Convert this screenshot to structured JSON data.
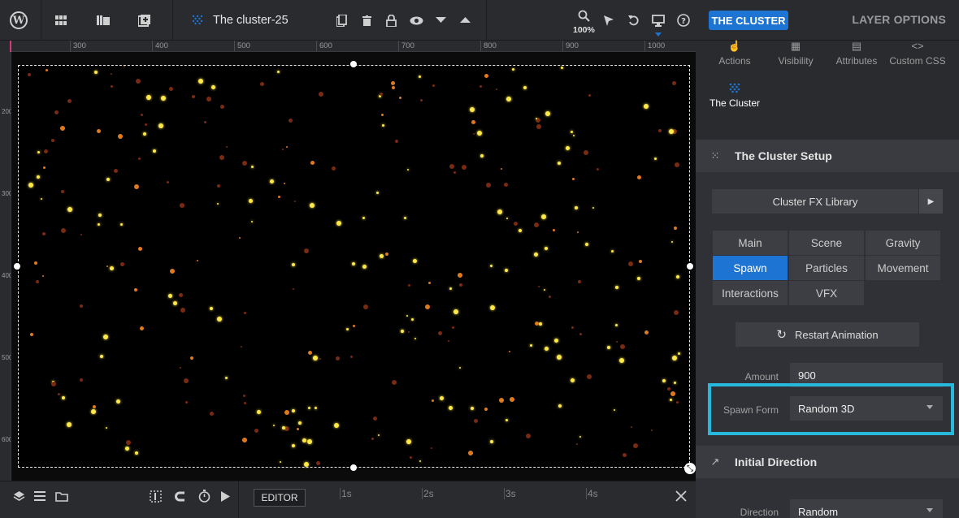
{
  "toolbar": {
    "title": "The cluster-25",
    "zoom": "100%",
    "icons": [
      "wordpress-icon",
      "grid-icon",
      "library-icon",
      "add-slide-icon",
      "cluster-icon",
      "duplicate-icon",
      "trash-icon",
      "lock-icon",
      "eye-icon",
      "chevron-down-icon",
      "chevron-up-icon",
      "search-icon",
      "pointer-icon",
      "undo-icon",
      "desktop-icon",
      "help-icon"
    ]
  },
  "ruler": {
    "top_labels": [
      "300",
      "400",
      "500",
      "600",
      "700",
      "800",
      "900",
      "1000"
    ],
    "left_labels": [
      "200",
      "300",
      "400",
      "500",
      "600"
    ]
  },
  "bottom": {
    "editor_label": "EDITOR",
    "timeline_labels": [
      "1s",
      "2s",
      "3s",
      "4s"
    ]
  },
  "panel": {
    "header_button": "THE CLUSTER",
    "layer_options": "LAYER OPTIONS",
    "tabs": [
      "Actions",
      "Visibility",
      "Attributes",
      "Custom CSS"
    ],
    "cluster_tab": "The Cluster",
    "setup_title": "The Cluster Setup",
    "library_label": "Cluster FX Library",
    "segments": [
      "Main",
      "Scene",
      "Gravity",
      "Spawn",
      "Particles",
      "Movement",
      "Interactions",
      "VFX"
    ],
    "active_segment": "Spawn",
    "restart_label": "Restart Animation",
    "amount_label": "Amount",
    "amount_value": "900",
    "spawn_form_label": "Spawn Form",
    "spawn_form_value": "Random 3D",
    "initial_direction_title": "Initial Direction",
    "direction_label": "Direction",
    "direction_value": "Random"
  },
  "colors": {
    "accent": "#1e74d2",
    "highlight": "#26b8dd",
    "particle_yellow": "#ffe84a",
    "particle_orange": "#e07a1f",
    "particle_red": "#7a2a12"
  }
}
